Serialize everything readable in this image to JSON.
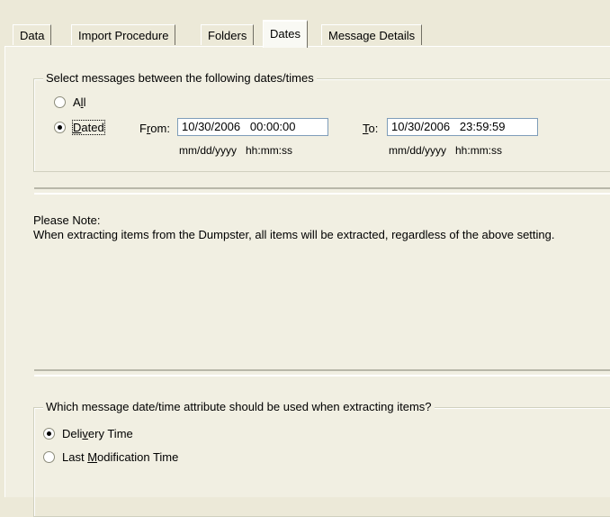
{
  "tabs": [
    {
      "label": "Data",
      "active": false
    },
    {
      "label": "Import Procedure",
      "active": false
    },
    {
      "label": "Folders",
      "active": false
    },
    {
      "label": "Dates",
      "active": true
    },
    {
      "label": "Message Details",
      "active": false
    }
  ],
  "date_range": {
    "legend": "Select messages between the following dates/times",
    "option_all": {
      "pre": "A",
      "accel": "l",
      "post": "l",
      "checked": false
    },
    "option_dated": {
      "pre": "",
      "accel": "D",
      "post": "ated",
      "checked": true
    },
    "from": {
      "pre": "F",
      "accel": "r",
      "post": "om:",
      "value": "10/30/2006   00:00:00",
      "format": "mm/dd/yyyy   hh:mm:ss"
    },
    "to": {
      "pre": "",
      "accel": "T",
      "post": "o:",
      "value": "10/30/2006   23:59:59",
      "format": "mm/dd/yyyy   hh:mm:ss"
    }
  },
  "note": {
    "title": "Please Note:",
    "text": "When extracting items from the Dumpster, all items will be extracted, regardless of the above setting."
  },
  "attribute": {
    "legend": "Which message date/time attribute should be used when extracting items?",
    "option_delivery": {
      "pre": "Deli",
      "accel": "v",
      "post": "ery Time",
      "checked": true
    },
    "option_modification": {
      "pre": "Last ",
      "accel": "M",
      "post": "odification Time",
      "checked": false
    }
  },
  "colors": {
    "tab_active_bg": "#f9f9f4",
    "panel_bg": "#f1efe2",
    "input_border": "#7f9db9"
  }
}
